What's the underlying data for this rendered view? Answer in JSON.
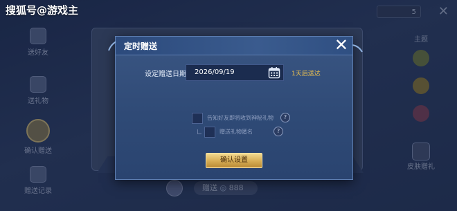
{
  "watermark": "搜狐号@游戏主",
  "background": {
    "left_nav": [
      {
        "label": "送好友"
      },
      {
        "label": "送礼物"
      },
      {
        "label": "确认赠送"
      },
      {
        "label": "赠送记录"
      }
    ],
    "right_nav": [
      {
        "label": "主题"
      },
      {
        "label": ""
      },
      {
        "label": ""
      },
      {
        "label": ""
      },
      {
        "label": "皮肤赠礼"
      }
    ],
    "coin": "5",
    "bottom_bar": {
      "send_label": "赠送",
      "amount": "888"
    }
  },
  "dialog": {
    "title": "定时赠送",
    "close_icon": "close-icon",
    "date_label": "设定赠送日期",
    "date_value": "2026/09/19",
    "calendar_icon": "calendar-icon",
    "date_note": "1天后送达",
    "option1": {
      "label": "告知好友即将收到神秘礼物",
      "checked": false
    },
    "option2": {
      "label": "赠送礼物匿名",
      "checked": false
    },
    "confirm_label": "确认设置"
  },
  "colors": {
    "accent_gold": "#d6ad55",
    "note_yellow": "#f0c44e",
    "dialog_bg": "#2f4a76"
  }
}
